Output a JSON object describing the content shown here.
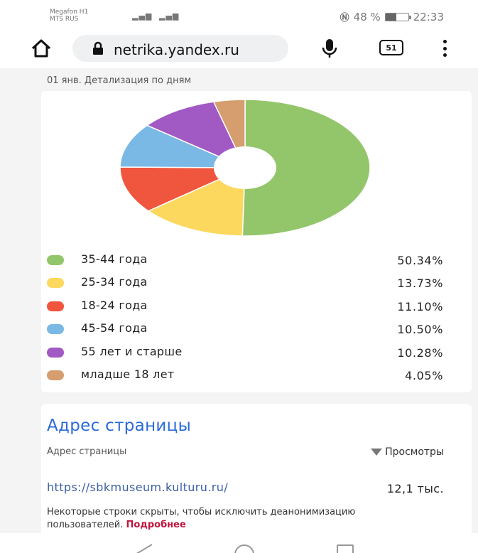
{
  "status": {
    "carrier_line1": "Megafon H1",
    "carrier_line2": "MTS RUS",
    "battery_percent": "48 %",
    "battery_level": 0.48,
    "time": "22:33"
  },
  "browser": {
    "url": "netrika.yandex.ru",
    "tab_count": "51",
    "icons": {
      "home": "home-icon",
      "lock": "lock-icon",
      "mic": "microphone-icon",
      "tabs": "tabs-icon",
      "menu": "overflow-menu-icon"
    }
  },
  "report": {
    "subtitle": "01 янв. Детализация по дням"
  },
  "chart_data": {
    "type": "pie",
    "categories": [
      "35-44 года",
      "25-34 года",
      "18-24 года",
      "45-54 года",
      "55 лет и старше",
      "младше 18 лет"
    ],
    "values": [
      50.34,
      13.73,
      11.1,
      10.5,
      10.28,
      4.05
    ],
    "colors": [
      "#93c66a",
      "#fcd95e",
      "#f0553e",
      "#7ab8e6",
      "#a159c4",
      "#d69d6e"
    ],
    "hole": true
  },
  "legend": [
    {
      "label": "35-44 года",
      "value": "50.34%",
      "color": "#93c66a"
    },
    {
      "label": "25-34 года",
      "value": "13.73%",
      "color": "#fcd95e"
    },
    {
      "label": "18-24 года",
      "value": "11.10%",
      "color": "#f0553e"
    },
    {
      "label": "45-54 года",
      "value": "10.50%",
      "color": "#7ab8e6"
    },
    {
      "label": "55 лет и старше",
      "value": "10.28%",
      "color": "#a159c4"
    },
    {
      "label": "младше 18 лет",
      "value": "4.05%",
      "color": "#d69d6e"
    }
  ],
  "page_address": {
    "title": "Адрес страницы",
    "column_left": "Адрес страницы",
    "column_right": "Просмотры",
    "row_url": "https://sbkmuseum.kulturu.ru/",
    "row_value": "12,1 тыс.",
    "note": "Некоторые строки скрыты, чтобы исключить деанонимизацию пользователей.",
    "note_link": "Подробнее"
  },
  "nav": {
    "back_icon": "back-icon",
    "home_icon": "home-circle-icon",
    "recent_icon": "recent-apps-icon"
  }
}
